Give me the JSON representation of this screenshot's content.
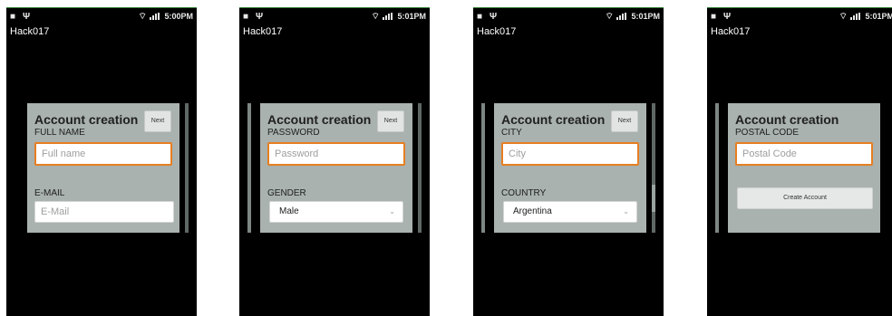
{
  "status": {
    "signal_icon": "signal-icon",
    "wifi_icon": "wifi-icon"
  },
  "screens": [
    {
      "time": "5:00PM",
      "app_title": "Hack017",
      "form_title": "Account creation",
      "next_label": "Next",
      "field1": {
        "label": "FULL NAME",
        "placeholder": "Full name"
      },
      "field2": {
        "label": "E-MAIL",
        "placeholder": "E-Mail"
      }
    },
    {
      "time": "5:01PM",
      "app_title": "Hack017",
      "form_title": "Account creation",
      "next_label": "Next",
      "field1": {
        "label": "PASSWORD",
        "placeholder": "Password"
      },
      "field2": {
        "label": "GENDER",
        "value": "Male"
      }
    },
    {
      "time": "5:01PM",
      "app_title": "Hack017",
      "form_title": "Account creation",
      "next_label": "Next",
      "field1": {
        "label": "CITY",
        "placeholder": "City"
      },
      "field2": {
        "label": "COUNTRY",
        "value": "Argentina"
      }
    },
    {
      "time": "5:01PM",
      "app_title": "Hack017",
      "form_title": "Account creation",
      "field1": {
        "label": "POSTAL CODE",
        "placeholder": "Postal Code"
      },
      "create_label": "Create Account"
    }
  ]
}
